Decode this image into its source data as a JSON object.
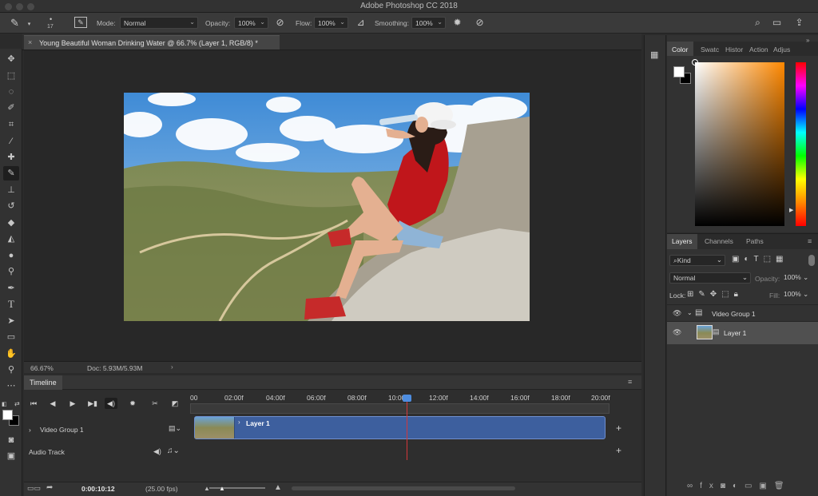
{
  "app": {
    "title": "Adobe Photoshop CC 2018"
  },
  "options_bar": {
    "brush_size": "17",
    "mode_label": "Mode:",
    "mode_value": "Normal",
    "opacity_label": "Opacity:",
    "opacity_value": "100%",
    "flow_label": "Flow:",
    "flow_value": "100%",
    "smoothing_label": "Smoothing:",
    "smoothing_value": "100%"
  },
  "document": {
    "tab_title": "Young Beautiful Woman Drinking Water @ 66.7% (Layer 1, RGB/8) *",
    "zoom": "66.67%",
    "doc_info": "Doc: 5.93M/5.93M"
  },
  "timeline": {
    "panel_title": "Timeline",
    "ticks": [
      "00",
      "02:00f",
      "04:00f",
      "06:00f",
      "08:00f",
      "10:00",
      "12:00f",
      "14:00f",
      "16:00f",
      "18:00f",
      "20:00f"
    ],
    "video_group_label": "Video Group 1",
    "audio_track_label": "Audio Track",
    "clip_label": "Layer 1",
    "current_time": "0:00:10:12",
    "fps": "(25.00 fps)",
    "playhead_seconds": 10.48
  },
  "color_panel": {
    "tabs": [
      "Color",
      "Swatc",
      "Histor",
      "Action",
      "Adjus"
    ],
    "foreground": "#ffffff",
    "background": "#000000",
    "hue_color": "#ff8800"
  },
  "layers_panel": {
    "tabs": [
      "Layers",
      "Channels",
      "Paths"
    ],
    "filter_kind": "Kind",
    "blend_mode": "Normal",
    "opacity_label": "Opacity:",
    "opacity_value": "100%",
    "lock_label": "Lock:",
    "fill_label": "Fill:",
    "fill_value": "100%",
    "layers": [
      {
        "name": "Video Group 1",
        "type": "group"
      },
      {
        "name": "Layer 1",
        "type": "video"
      }
    ]
  }
}
